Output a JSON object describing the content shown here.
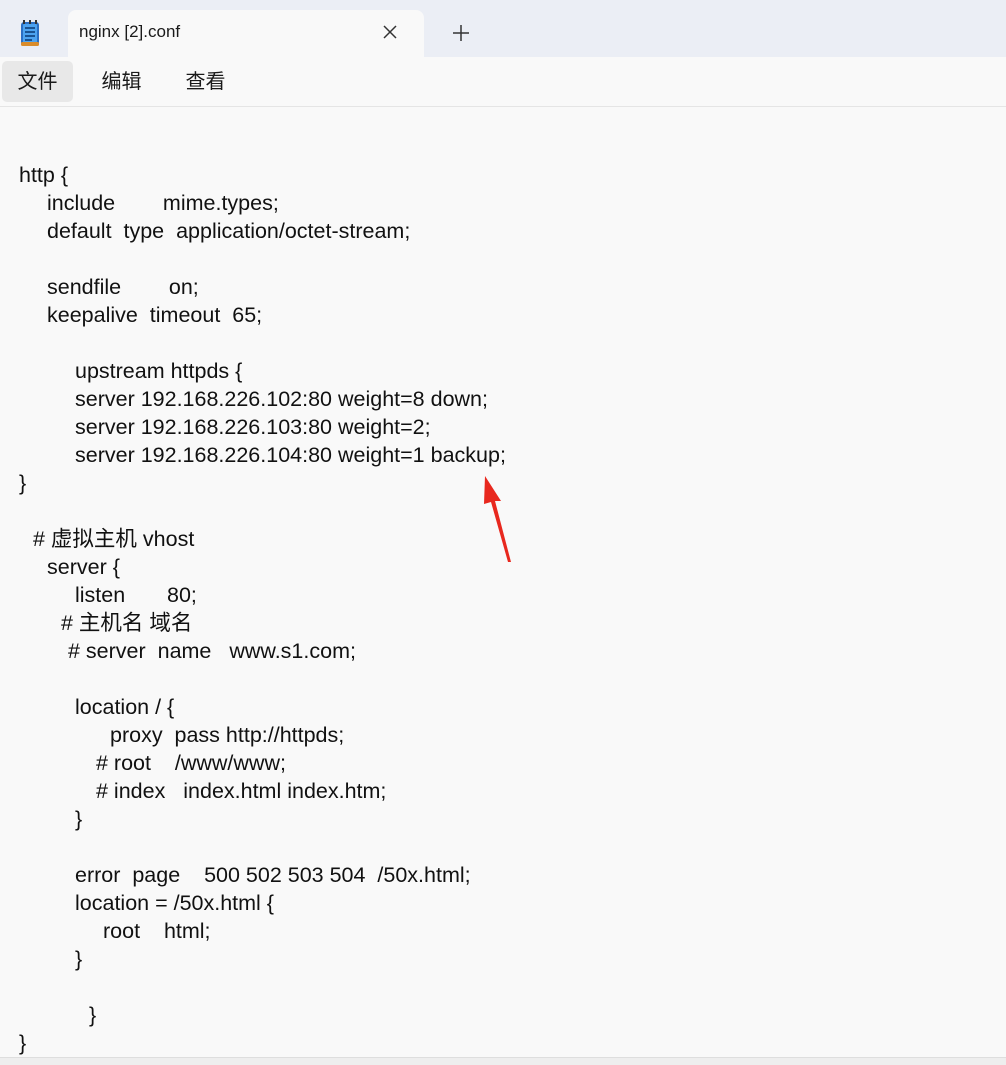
{
  "tab": {
    "title": "nginx [2].conf",
    "close_icon": "close-icon",
    "new_tab_icon": "plus-icon"
  },
  "app_icon": "notepad-icon",
  "menu": {
    "items": [
      {
        "label": "文件"
      },
      {
        "label": "编辑"
      },
      {
        "label": "查看"
      }
    ]
  },
  "editor": {
    "lines": [
      "http {",
      "include        mime.types;",
      "default  type  application/octet-stream;",
      "sendfile        on;",
      "keepalive  timeout  65;",
      "upstream httpds {",
      "server 192.168.226.102:80 weight=8 down;",
      "server 192.168.226.103:80 weight=2;",
      "server 192.168.226.104:80 weight=1 backup;",
      "}",
      "# 虚拟主机 vhost",
      "server {",
      "listen       80;",
      "# 主机名 域名",
      "# server  name   www.s1.com;",
      "location / {",
      "proxy  pass http://httpds;",
      "# root    /www/www;",
      "# index   index.html index.htm;",
      "}",
      "error  page    500 502 503 504  /50x.html;",
      "location = /50x.html {",
      "root    html;",
      "}",
      "}",
      "}"
    ]
  },
  "annotation": {
    "arrow_icon": "red-arrow-icon",
    "arrow_color": "#e8281e"
  },
  "colors": {
    "tabbar_bg": "#ebeef5",
    "editor_bg": "#f9f9f9",
    "text": "#111111",
    "menu_active_bg": "#e8e8e8"
  }
}
